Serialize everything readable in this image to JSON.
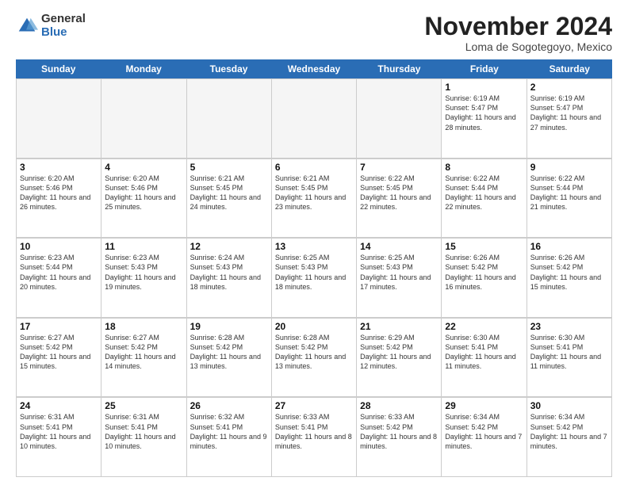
{
  "logo": {
    "general": "General",
    "blue": "Blue"
  },
  "header": {
    "month": "November 2024",
    "location": "Loma de Sogotegoyo, Mexico"
  },
  "weekdays": [
    "Sunday",
    "Monday",
    "Tuesday",
    "Wednesday",
    "Thursday",
    "Friday",
    "Saturday"
  ],
  "rows": [
    [
      {
        "day": "",
        "info": ""
      },
      {
        "day": "",
        "info": ""
      },
      {
        "day": "",
        "info": ""
      },
      {
        "day": "",
        "info": ""
      },
      {
        "day": "",
        "info": ""
      },
      {
        "day": "1",
        "info": "Sunrise: 6:19 AM\nSunset: 5:47 PM\nDaylight: 11 hours and 28 minutes."
      },
      {
        "day": "2",
        "info": "Sunrise: 6:19 AM\nSunset: 5:47 PM\nDaylight: 11 hours and 27 minutes."
      }
    ],
    [
      {
        "day": "3",
        "info": "Sunrise: 6:20 AM\nSunset: 5:46 PM\nDaylight: 11 hours and 26 minutes."
      },
      {
        "day": "4",
        "info": "Sunrise: 6:20 AM\nSunset: 5:46 PM\nDaylight: 11 hours and 25 minutes."
      },
      {
        "day": "5",
        "info": "Sunrise: 6:21 AM\nSunset: 5:45 PM\nDaylight: 11 hours and 24 minutes."
      },
      {
        "day": "6",
        "info": "Sunrise: 6:21 AM\nSunset: 5:45 PM\nDaylight: 11 hours and 23 minutes."
      },
      {
        "day": "7",
        "info": "Sunrise: 6:22 AM\nSunset: 5:45 PM\nDaylight: 11 hours and 22 minutes."
      },
      {
        "day": "8",
        "info": "Sunrise: 6:22 AM\nSunset: 5:44 PM\nDaylight: 11 hours and 22 minutes."
      },
      {
        "day": "9",
        "info": "Sunrise: 6:22 AM\nSunset: 5:44 PM\nDaylight: 11 hours and 21 minutes."
      }
    ],
    [
      {
        "day": "10",
        "info": "Sunrise: 6:23 AM\nSunset: 5:44 PM\nDaylight: 11 hours and 20 minutes."
      },
      {
        "day": "11",
        "info": "Sunrise: 6:23 AM\nSunset: 5:43 PM\nDaylight: 11 hours and 19 minutes."
      },
      {
        "day": "12",
        "info": "Sunrise: 6:24 AM\nSunset: 5:43 PM\nDaylight: 11 hours and 18 minutes."
      },
      {
        "day": "13",
        "info": "Sunrise: 6:25 AM\nSunset: 5:43 PM\nDaylight: 11 hours and 18 minutes."
      },
      {
        "day": "14",
        "info": "Sunrise: 6:25 AM\nSunset: 5:43 PM\nDaylight: 11 hours and 17 minutes."
      },
      {
        "day": "15",
        "info": "Sunrise: 6:26 AM\nSunset: 5:42 PM\nDaylight: 11 hours and 16 minutes."
      },
      {
        "day": "16",
        "info": "Sunrise: 6:26 AM\nSunset: 5:42 PM\nDaylight: 11 hours and 15 minutes."
      }
    ],
    [
      {
        "day": "17",
        "info": "Sunrise: 6:27 AM\nSunset: 5:42 PM\nDaylight: 11 hours and 15 minutes."
      },
      {
        "day": "18",
        "info": "Sunrise: 6:27 AM\nSunset: 5:42 PM\nDaylight: 11 hours and 14 minutes."
      },
      {
        "day": "19",
        "info": "Sunrise: 6:28 AM\nSunset: 5:42 PM\nDaylight: 11 hours and 13 minutes."
      },
      {
        "day": "20",
        "info": "Sunrise: 6:28 AM\nSunset: 5:42 PM\nDaylight: 11 hours and 13 minutes."
      },
      {
        "day": "21",
        "info": "Sunrise: 6:29 AM\nSunset: 5:42 PM\nDaylight: 11 hours and 12 minutes."
      },
      {
        "day": "22",
        "info": "Sunrise: 6:30 AM\nSunset: 5:41 PM\nDaylight: 11 hours and 11 minutes."
      },
      {
        "day": "23",
        "info": "Sunrise: 6:30 AM\nSunset: 5:41 PM\nDaylight: 11 hours and 11 minutes."
      }
    ],
    [
      {
        "day": "24",
        "info": "Sunrise: 6:31 AM\nSunset: 5:41 PM\nDaylight: 11 hours and 10 minutes."
      },
      {
        "day": "25",
        "info": "Sunrise: 6:31 AM\nSunset: 5:41 PM\nDaylight: 11 hours and 10 minutes."
      },
      {
        "day": "26",
        "info": "Sunrise: 6:32 AM\nSunset: 5:41 PM\nDaylight: 11 hours and 9 minutes."
      },
      {
        "day": "27",
        "info": "Sunrise: 6:33 AM\nSunset: 5:41 PM\nDaylight: 11 hours and 8 minutes."
      },
      {
        "day": "28",
        "info": "Sunrise: 6:33 AM\nSunset: 5:42 PM\nDaylight: 11 hours and 8 minutes."
      },
      {
        "day": "29",
        "info": "Sunrise: 6:34 AM\nSunset: 5:42 PM\nDaylight: 11 hours and 7 minutes."
      },
      {
        "day": "30",
        "info": "Sunrise: 6:34 AM\nSunset: 5:42 PM\nDaylight: 11 hours and 7 minutes."
      }
    ]
  ]
}
